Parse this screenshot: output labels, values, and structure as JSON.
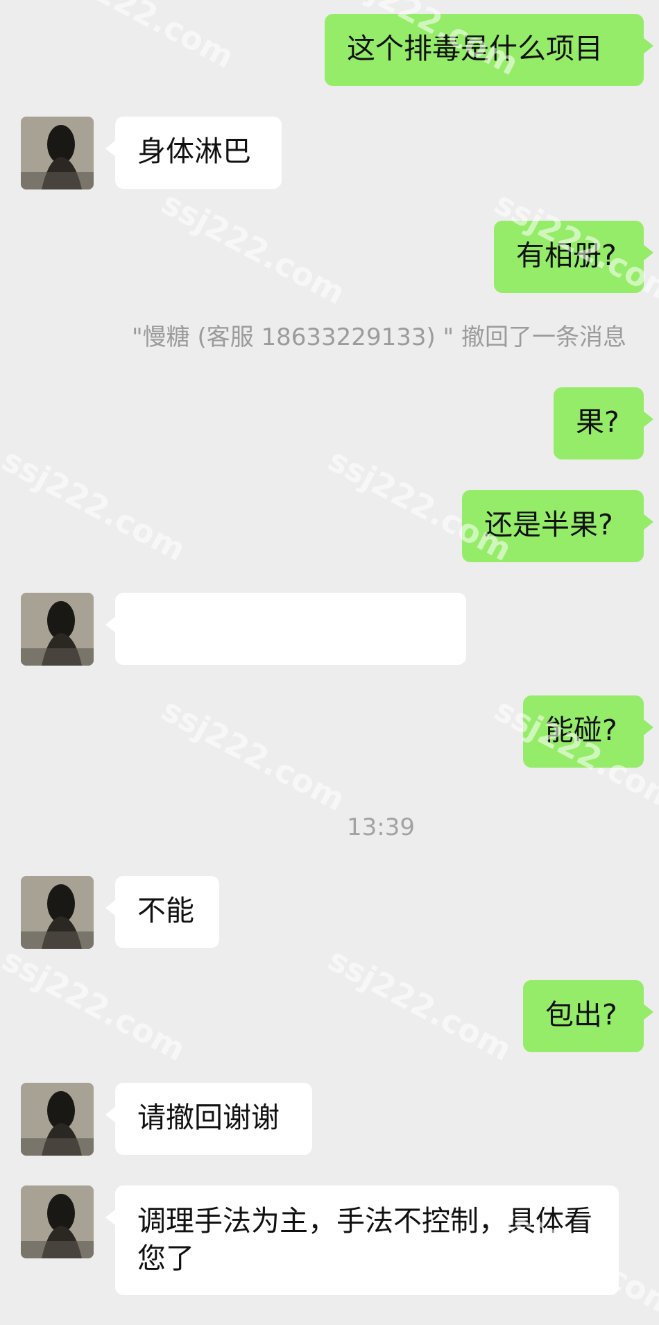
{
  "messages": [
    {
      "id": "m1",
      "side": "out",
      "text": "这个排毒是什么项目"
    },
    {
      "id": "m2",
      "side": "in",
      "text": "身体淋巴"
    },
    {
      "id": "m3",
      "side": "out",
      "text": "有相册?"
    },
    {
      "id": "m4",
      "side": "out",
      "text": "果?"
    },
    {
      "id": "m5",
      "side": "out",
      "text": "还是半果?"
    },
    {
      "id": "m6",
      "side": "in",
      "text": ""
    },
    {
      "id": "m7",
      "side": "out",
      "text": "能碰?"
    },
    {
      "id": "m8",
      "side": "in",
      "text": "不能"
    },
    {
      "id": "m9",
      "side": "out",
      "text": "包出?"
    },
    {
      "id": "m10",
      "side": "in",
      "text": "请撤回谢谢"
    },
    {
      "id": "m11",
      "side": "in",
      "text": "调理手法为主，手法不控制，具体看您了"
    }
  ],
  "system": {
    "recall_notice": "\"慢糖 (客服 18633229133) \" 撤回了一条消息",
    "timestamp": "13:39"
  },
  "watermark": "ssj222.com",
  "colors": {
    "background": "#ededed",
    "outgoing_bubble": "#95ec69",
    "incoming_bubble": "#ffffff",
    "system_text": "#9b9b9b"
  }
}
